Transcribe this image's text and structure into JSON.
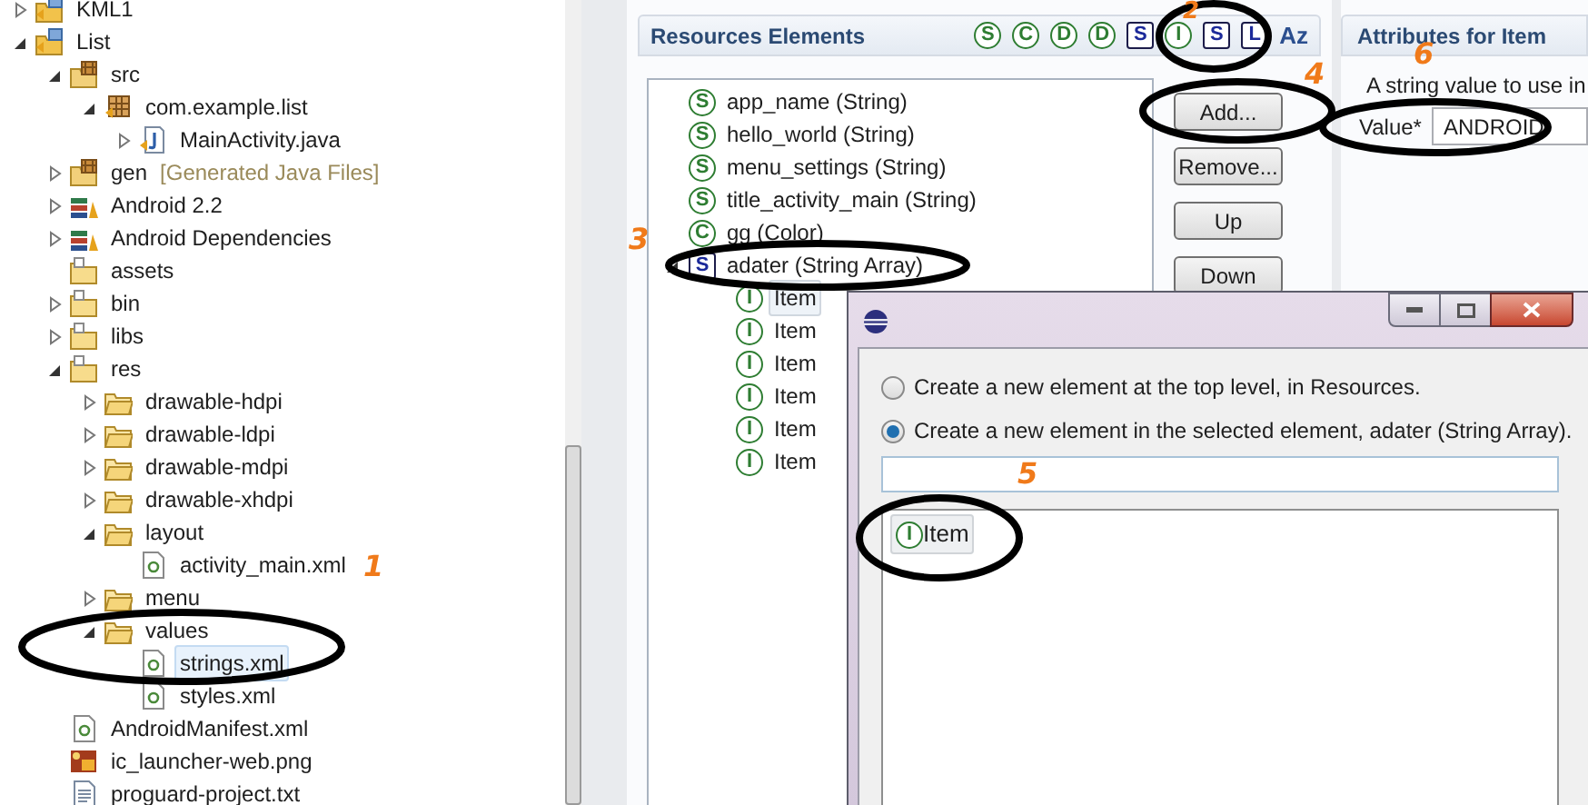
{
  "project_tree": [
    {
      "label": "KML1",
      "kind": "project",
      "expanded": false,
      "selected": false
    },
    {
      "label": "List",
      "kind": "project",
      "expanded": true,
      "selected": false,
      "children": [
        {
          "label": "src",
          "kind": "source-folder",
          "expanded": true,
          "selected": false,
          "children": [
            {
              "label": "com.example.list",
              "kind": "package",
              "expanded": true,
              "selected": false,
              "children": [
                {
                  "label": "MainActivity.java",
                  "kind": "java",
                  "expanded": false,
                  "selected": false
                }
              ]
            }
          ]
        },
        {
          "label": "gen",
          "suffix": "[Generated Java Files]",
          "kind": "source-folder",
          "expanded": false,
          "selected": false
        },
        {
          "label": "Android 2.2",
          "kind": "library",
          "expanded": false,
          "selected": false
        },
        {
          "label": "Android Dependencies",
          "kind": "library",
          "expanded": false,
          "selected": false
        },
        {
          "label": "assets",
          "kind": "project-folder",
          "selected": false
        },
        {
          "label": "bin",
          "kind": "project-folder",
          "expanded": false,
          "selected": false
        },
        {
          "label": "libs",
          "kind": "project-folder",
          "expanded": false,
          "selected": false
        },
        {
          "label": "res",
          "kind": "project-folder",
          "expanded": true,
          "selected": false,
          "children": [
            {
              "label": "drawable-hdpi",
              "kind": "folder",
              "expanded": false,
              "selected": false
            },
            {
              "label": "drawable-ldpi",
              "kind": "folder",
              "expanded": false,
              "selected": false
            },
            {
              "label": "drawable-mdpi",
              "kind": "folder",
              "expanded": false,
              "selected": false
            },
            {
              "label": "drawable-xhdpi",
              "kind": "folder",
              "expanded": false,
              "selected": false
            },
            {
              "label": "layout",
              "kind": "folder",
              "expanded": true,
              "selected": false,
              "children": [
                {
                  "label": "activity_main.xml",
                  "kind": "xml",
                  "selected": false
                }
              ]
            },
            {
              "label": "menu",
              "kind": "folder",
              "expanded": false,
              "selected": false
            },
            {
              "label": "values",
              "kind": "folder",
              "expanded": true,
              "selected": false,
              "children": [
                {
                  "label": "strings.xml",
                  "kind": "xml",
                  "selected": true
                },
                {
                  "label": "styles.xml",
                  "kind": "xml",
                  "selected": false
                }
              ]
            }
          ]
        },
        {
          "label": "AndroidManifest.xml",
          "kind": "xml",
          "selected": false
        },
        {
          "label": "ic_launcher-web.png",
          "kind": "png",
          "selected": false
        },
        {
          "label": "proguard-project.txt",
          "kind": "txt",
          "selected": false
        }
      ]
    }
  ],
  "resources": {
    "title": "Resources Elements",
    "toolbar": [
      {
        "badge": "S",
        "kind": "circle"
      },
      {
        "badge": "C",
        "kind": "circle"
      },
      {
        "badge": "D",
        "kind": "circle"
      },
      {
        "badge": "D",
        "kind": "circle"
      },
      {
        "badge": "S",
        "kind": "square"
      },
      {
        "badge": "I",
        "kind": "circle"
      },
      {
        "badge": "S",
        "kind": "square"
      },
      {
        "badge": "L",
        "kind": "square"
      },
      {
        "badge": "Az",
        "kind": "plain"
      }
    ],
    "tree": [
      {
        "label": "app_name (String)",
        "badge": "S",
        "kind": "circle",
        "selected": false
      },
      {
        "label": "hello_world (String)",
        "badge": "S",
        "kind": "circle",
        "selected": false
      },
      {
        "label": "menu_settings (String)",
        "badge": "S",
        "kind": "circle",
        "selected": false
      },
      {
        "label": "title_activity_main (String)",
        "badge": "S",
        "kind": "circle",
        "selected": false
      },
      {
        "label": "gg (Color)",
        "badge": "C",
        "kind": "circle",
        "selected": false
      },
      {
        "label": "adater (String Array)",
        "badge": "S",
        "kind": "square",
        "expanded": true,
        "selected": false,
        "children": [
          {
            "label": "Item",
            "badge": "I",
            "kind": "circle",
            "selected": true
          },
          {
            "label": "Item",
            "badge": "I",
            "kind": "circle",
            "selected": false
          },
          {
            "label": "Item",
            "badge": "I",
            "kind": "circle",
            "selected": false
          },
          {
            "label": "Item",
            "badge": "I",
            "kind": "circle",
            "selected": false
          },
          {
            "label": "Item",
            "badge": "I",
            "kind": "circle",
            "selected": false
          },
          {
            "label": "Item",
            "badge": "I",
            "kind": "circle",
            "selected": false
          }
        ]
      }
    ],
    "buttons": [
      "Add...",
      "Remove...",
      "Up",
      "Down"
    ]
  },
  "attributes": {
    "title": "Attributes for Item",
    "description": "A string value to use in",
    "field_label": "Value*",
    "value": "ANDROID"
  },
  "dialog": {
    "options": [
      {
        "label": "Create a new element at the top level, in Resources.",
        "selected": false
      },
      {
        "label": "Create a new element in the selected element, adater (String Array).",
        "selected": true
      }
    ],
    "list": [
      {
        "label": "Item",
        "badge": "I",
        "kind": "circle",
        "selected": true
      }
    ]
  },
  "annotations": [
    {
      "number": "1"
    },
    {
      "number": "2"
    },
    {
      "number": "4"
    },
    {
      "number": "3"
    },
    {
      "number": "5"
    },
    {
      "number": "6"
    }
  ]
}
